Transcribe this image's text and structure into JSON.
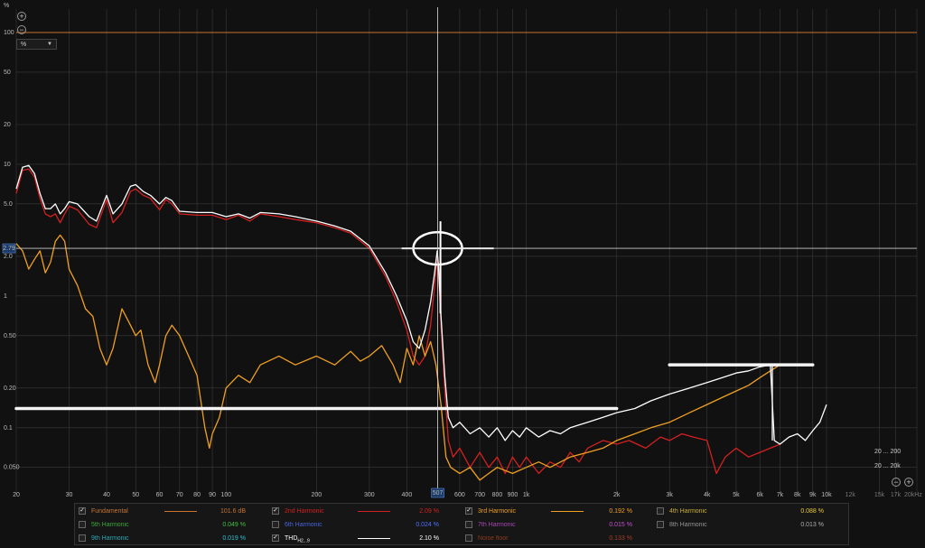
{
  "y_axis": {
    "unit": "%",
    "unit_select": "%",
    "cursor_value": "2.79"
  },
  "x_axis": {
    "cursor_value": "507"
  },
  "zoom_ranges": {
    "top": "20 ... 200",
    "bottom": "20 ... 20k"
  },
  "legend": [
    {
      "label": "Fundamental",
      "value": "101.6 dB",
      "checked": true,
      "color": "#c87533",
      "swatch": true
    },
    {
      "label": "2nd Harmonic",
      "value": "2.09 %",
      "checked": true,
      "color": "#d42020",
      "swatch": true
    },
    {
      "label": "3rd Harmonic",
      "value": "0.192 %",
      "checked": true,
      "color": "#f0a020",
      "swatch": true
    },
    {
      "label": "4th Harmonic",
      "value": "0.088 %",
      "checked": false,
      "color": "#e8c838",
      "swatch": false
    },
    {
      "label": "5th Harmonic",
      "value": "0.049 %",
      "checked": false,
      "color": "#40c040",
      "swatch": false
    },
    {
      "label": "6th Harmonic",
      "value": "0.024 %",
      "checked": false,
      "color": "#5070ff",
      "swatch": false
    },
    {
      "label": "7th Harmonic",
      "value": "0.015 %",
      "checked": false,
      "color": "#c050d0",
      "swatch": false
    },
    {
      "label": "8th Harmonic",
      "value": "0.013 %",
      "checked": false,
      "color": "#aaaaaa",
      "swatch": false
    },
    {
      "label": "9th Harmonic",
      "value": "0.019 %",
      "checked": false,
      "color": "#30c0d0",
      "swatch": false
    },
    {
      "label": "THD",
      "label_sub": "H2...9",
      "value": "2.10 %",
      "checked": true,
      "color": "#ffffff",
      "swatch": true
    },
    {
      "label": "Noise floor",
      "value": "0.133 %",
      "checked": false,
      "color": "#a04020",
      "swatch": false
    }
  ],
  "chart_data": {
    "type": "line",
    "xlabel": "",
    "ylabel": "%",
    "x_scale": "log",
    "y_scale": "log",
    "xlim": [
      20,
      20000
    ],
    "ylim": [
      0.03,
      200
    ],
    "x_ticks": [
      "20",
      "30",
      "40",
      "50",
      "60",
      "70",
      "80",
      "90",
      "100",
      "200",
      "300",
      "400",
      "600",
      "700",
      "800",
      "900",
      "1k",
      "2k",
      "3k",
      "4k",
      "5k",
      "6k",
      "7k",
      "8k",
      "9k",
      "10k",
      "15k",
      "17k",
      "20kHz"
    ],
    "x_ticks_dim": [
      "12k"
    ],
    "y_ticks": [
      "100",
      "50",
      "20",
      "10",
      "5.0",
      "2.0",
      "1",
      "0.50",
      "0.20",
      "0.1",
      "0.050"
    ],
    "grid": true,
    "series": [
      {
        "name": "Fundamental",
        "color": "#c87533",
        "points": [
          [
            20,
            100
          ],
          [
            20000,
            100
          ]
        ]
      },
      {
        "name": "2nd Harmonic",
        "color": "#d42020",
        "points": [
          [
            20,
            6.0
          ],
          [
            21,
            9.0
          ],
          [
            22,
            9.2
          ],
          [
            23,
            8
          ],
          [
            24,
            5.5
          ],
          [
            25,
            4.2
          ],
          [
            26,
            4.0
          ],
          [
            27,
            4.2
          ],
          [
            28,
            3.6
          ],
          [
            29,
            4.2
          ],
          [
            30,
            4.8
          ],
          [
            32,
            4.5
          ],
          [
            35,
            3.5
          ],
          [
            37,
            3.3
          ],
          [
            40,
            5.4
          ],
          [
            42,
            3.6
          ],
          [
            45,
            4.3
          ],
          [
            48,
            6.2
          ],
          [
            50,
            6.5
          ],
          [
            53,
            5.8
          ],
          [
            56,
            5.5
          ],
          [
            60,
            4.5
          ],
          [
            63,
            5.4
          ],
          [
            66,
            5.0
          ],
          [
            70,
            4.2
          ],
          [
            80,
            4.1
          ],
          [
            90,
            4.1
          ],
          [
            100,
            3.8
          ],
          [
            110,
            4.1
          ],
          [
            120,
            3.7
          ],
          [
            130,
            4.2
          ],
          [
            150,
            4.0
          ],
          [
            170,
            3.8
          ],
          [
            200,
            3.6
          ],
          [
            230,
            3.3
          ],
          [
            260,
            3.0
          ],
          [
            300,
            2.3
          ],
          [
            340,
            1.4
          ],
          [
            370,
            0.9
          ],
          [
            400,
            0.55
          ],
          [
            420,
            0.35
          ],
          [
            440,
            0.3
          ],
          [
            460,
            0.35
          ],
          [
            480,
            0.6
          ],
          [
            495,
            1.2
          ],
          [
            505,
            2.0
          ],
          [
            510,
            1.5
          ],
          [
            520,
            0.6
          ],
          [
            535,
            0.2
          ],
          [
            550,
            0.08
          ],
          [
            570,
            0.06
          ],
          [
            600,
            0.07
          ],
          [
            650,
            0.05
          ],
          [
            700,
            0.065
          ],
          [
            750,
            0.05
          ],
          [
            800,
            0.06
          ],
          [
            850,
            0.045
          ],
          [
            900,
            0.06
          ],
          [
            950,
            0.05
          ],
          [
            1000,
            0.06
          ],
          [
            1100,
            0.045
          ],
          [
            1200,
            0.055
          ],
          [
            1300,
            0.05
          ],
          [
            1400,
            0.065
          ],
          [
            1500,
            0.055
          ],
          [
            1600,
            0.07
          ],
          [
            1800,
            0.08
          ],
          [
            2000,
            0.075
          ],
          [
            2200,
            0.08
          ],
          [
            2500,
            0.07
          ],
          [
            2800,
            0.085
          ],
          [
            3000,
            0.08
          ],
          [
            3300,
            0.09
          ],
          [
            3600,
            0.085
          ],
          [
            4000,
            0.08
          ],
          [
            4300,
            0.045
          ],
          [
            4600,
            0.06
          ],
          [
            5000,
            0.07
          ],
          [
            5500,
            0.06
          ],
          [
            6000,
            0.065
          ],
          [
            6500,
            0.07
          ],
          [
            7000,
            0.075
          ]
        ]
      },
      {
        "name": "3rd Harmonic",
        "color": "#f0a020",
        "points": [
          [
            20,
            2.5
          ],
          [
            21,
            2.2
          ],
          [
            22,
            1.6
          ],
          [
            23,
            1.9
          ],
          [
            24,
            2.2
          ],
          [
            25,
            1.5
          ],
          [
            26,
            1.8
          ],
          [
            27,
            2.6
          ],
          [
            28,
            2.9
          ],
          [
            29,
            2.6
          ],
          [
            30,
            1.6
          ],
          [
            32,
            1.2
          ],
          [
            34,
            0.8
          ],
          [
            36,
            0.7
          ],
          [
            38,
            0.4
          ],
          [
            40,
            0.3
          ],
          [
            42,
            0.4
          ],
          [
            45,
            0.8
          ],
          [
            48,
            0.6
          ],
          [
            50,
            0.5
          ],
          [
            52,
            0.55
          ],
          [
            55,
            0.3
          ],
          [
            58,
            0.22
          ],
          [
            60,
            0.3
          ],
          [
            63,
            0.5
          ],
          [
            66,
            0.6
          ],
          [
            70,
            0.5
          ],
          [
            75,
            0.35
          ],
          [
            80,
            0.25
          ],
          [
            85,
            0.1
          ],
          [
            88,
            0.07
          ],
          [
            90,
            0.09
          ],
          [
            95,
            0.12
          ],
          [
            100,
            0.2
          ],
          [
            110,
            0.25
          ],
          [
            120,
            0.22
          ],
          [
            130,
            0.3
          ],
          [
            150,
            0.35
          ],
          [
            170,
            0.3
          ],
          [
            200,
            0.35
          ],
          [
            230,
            0.3
          ],
          [
            260,
            0.38
          ],
          [
            280,
            0.32
          ],
          [
            300,
            0.35
          ],
          [
            330,
            0.42
          ],
          [
            360,
            0.3
          ],
          [
            380,
            0.22
          ],
          [
            400,
            0.4
          ],
          [
            420,
            0.3
          ],
          [
            440,
            0.5
          ],
          [
            460,
            0.35
          ],
          [
            480,
            0.45
          ],
          [
            500,
            0.3
          ],
          [
            520,
            0.15
          ],
          [
            540,
            0.06
          ],
          [
            560,
            0.05
          ],
          [
            600,
            0.045
          ],
          [
            650,
            0.05
          ],
          [
            700,
            0.04
          ],
          [
            750,
            0.045
          ],
          [
            800,
            0.05
          ],
          [
            900,
            0.045
          ],
          [
            1000,
            0.05
          ],
          [
            1100,
            0.055
          ],
          [
            1200,
            0.05
          ],
          [
            1400,
            0.06
          ],
          [
            1600,
            0.065
          ],
          [
            1800,
            0.07
          ],
          [
            2000,
            0.08
          ],
          [
            2300,
            0.09
          ],
          [
            2600,
            0.1
          ],
          [
            3000,
            0.11
          ],
          [
            3500,
            0.13
          ],
          [
            4000,
            0.15
          ],
          [
            4500,
            0.17
          ],
          [
            5000,
            0.19
          ],
          [
            5500,
            0.21
          ],
          [
            6000,
            0.24
          ],
          [
            6500,
            0.27
          ],
          [
            7000,
            0.3
          ]
        ]
      },
      {
        "name": "THD",
        "color": "#ffffff",
        "points": [
          [
            20,
            6.5
          ],
          [
            21,
            9.5
          ],
          [
            22,
            9.8
          ],
          [
            23,
            8.5
          ],
          [
            24,
            6.0
          ],
          [
            25,
            4.6
          ],
          [
            26,
            4.6
          ],
          [
            27,
            5.0
          ],
          [
            28,
            4.2
          ],
          [
            29,
            4.6
          ],
          [
            30,
            5.2
          ],
          [
            32,
            5.0
          ],
          [
            35,
            4.0
          ],
          [
            37,
            3.7
          ],
          [
            40,
            5.8
          ],
          [
            42,
            4.2
          ],
          [
            45,
            5.0
          ],
          [
            48,
            6.8
          ],
          [
            50,
            7.0
          ],
          [
            53,
            6.2
          ],
          [
            56,
            5.8
          ],
          [
            60,
            5.0
          ],
          [
            63,
            5.6
          ],
          [
            66,
            5.3
          ],
          [
            70,
            4.4
          ],
          [
            80,
            4.3
          ],
          [
            90,
            4.3
          ],
          [
            100,
            4.0
          ],
          [
            110,
            4.2
          ],
          [
            120,
            3.9
          ],
          [
            130,
            4.3
          ],
          [
            150,
            4.2
          ],
          [
            170,
            4.0
          ],
          [
            200,
            3.7
          ],
          [
            230,
            3.4
          ],
          [
            260,
            3.1
          ],
          [
            300,
            2.4
          ],
          [
            340,
            1.5
          ],
          [
            370,
            1.0
          ],
          [
            400,
            0.65
          ],
          [
            420,
            0.45
          ],
          [
            440,
            0.4
          ],
          [
            460,
            0.55
          ],
          [
            480,
            0.9
          ],
          [
            495,
            1.5
          ],
          [
            505,
            2.2
          ],
          [
            510,
            1.7
          ],
          [
            520,
            0.7
          ],
          [
            535,
            0.25
          ],
          [
            550,
            0.12
          ],
          [
            570,
            0.1
          ],
          [
            600,
            0.11
          ],
          [
            650,
            0.09
          ],
          [
            700,
            0.1
          ],
          [
            750,
            0.085
          ],
          [
            800,
            0.1
          ],
          [
            850,
            0.08
          ],
          [
            900,
            0.095
          ],
          [
            950,
            0.085
          ],
          [
            1000,
            0.1
          ],
          [
            1100,
            0.085
          ],
          [
            1200,
            0.095
          ],
          [
            1300,
            0.09
          ],
          [
            1400,
            0.1
          ],
          [
            1600,
            0.11
          ],
          [
            1800,
            0.12
          ],
          [
            2000,
            0.13
          ],
          [
            2300,
            0.14
          ],
          [
            2600,
            0.16
          ],
          [
            3000,
            0.18
          ],
          [
            3500,
            0.2
          ],
          [
            4000,
            0.22
          ],
          [
            4500,
            0.24
          ],
          [
            5000,
            0.26
          ],
          [
            5500,
            0.27
          ],
          [
            6000,
            0.29
          ],
          [
            6500,
            0.3
          ],
          [
            6700,
            0.08
          ],
          [
            7000,
            0.075
          ],
          [
            7500,
            0.085
          ],
          [
            8000,
            0.09
          ],
          [
            8500,
            0.08
          ],
          [
            9000,
            0.095
          ],
          [
            9500,
            0.11
          ],
          [
            10000,
            0.15
          ]
        ]
      }
    ],
    "annotations": {
      "cursor_x": 507,
      "cursor_y": 2.3,
      "markup_lines": [
        {
          "x1": 20,
          "x2": 2000,
          "y": 0.14
        },
        {
          "x1": 3000,
          "x2": 9000,
          "y": 0.3
        }
      ]
    }
  }
}
